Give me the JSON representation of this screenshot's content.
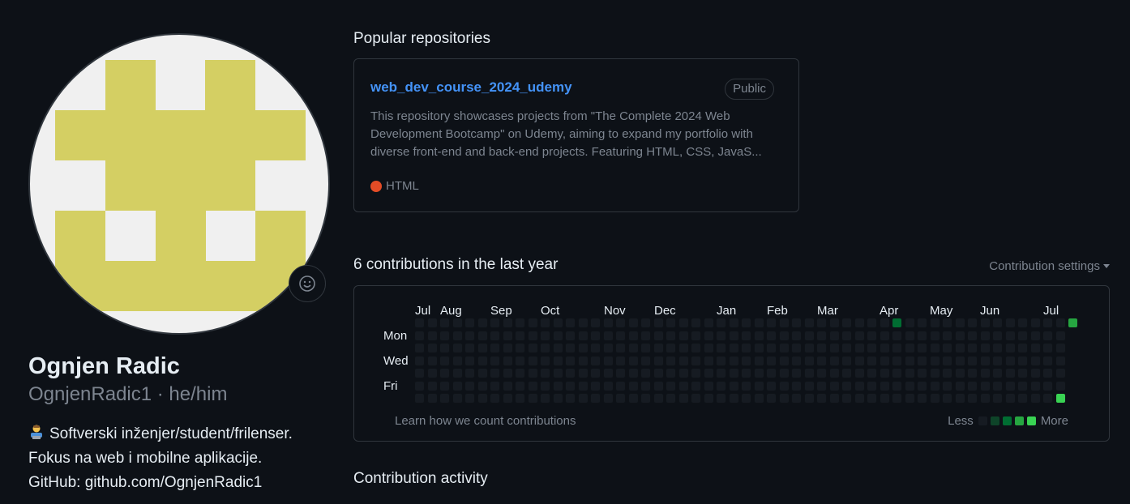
{
  "profile": {
    "name": "Ognjen Radic",
    "login_pronouns": "OgnjenRadic1 · he/him",
    "bio_lines": [
      "Softverski inženjer/student/frilenser.",
      "Fokus na web i mobilne aplikacije.",
      "GitHub: github.com/OgnjenRadic1"
    ],
    "avatar_color": "#d4cf63",
    "status_icon": "smiley-icon",
    "bio_emoji": "technologist-icon"
  },
  "popular": {
    "title": "Popular repositories",
    "repos": [
      {
        "name": "web_dev_course_2024_udemy",
        "visibility": "Public",
        "description": "This repository showcases projects from \"The Complete 2024 Web Development Bootcamp\" on Udemy, aiming to expand my portfolio with diverse front-end and back-end projects. Featuring HTML, CSS, JavaS...",
        "language": "HTML",
        "language_color": "#e34c26"
      }
    ]
  },
  "contributions": {
    "title": "6 contributions in the last year",
    "settings_label": "Contribution settings",
    "months": [
      "Jul",
      "Aug",
      "Sep",
      "Oct",
      "Nov",
      "Dec",
      "Jan",
      "Feb",
      "Mar",
      "Apr",
      "May",
      "Jun",
      "Jul"
    ],
    "days": [
      "Mon",
      "Wed",
      "Fri"
    ],
    "learn_link": "Learn how we count contributions",
    "legend_less": "Less",
    "legend_more": "More",
    "colors": [
      "#161b22",
      "#0e4429",
      "#006d32",
      "#26a641",
      "#39d353"
    ],
    "active_cells": [
      {
        "week": 38,
        "day": 1,
        "level": 2
      },
      {
        "week": 52,
        "day": 1,
        "level": 3
      },
      {
        "week": 51,
        "day": 7,
        "level": 4
      }
    ]
  },
  "activity": {
    "title": "Contribution activity"
  }
}
